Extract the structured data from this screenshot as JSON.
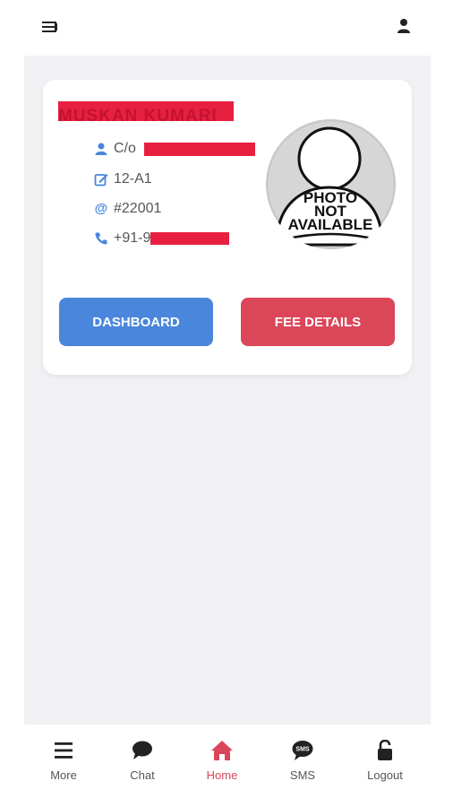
{
  "header": {
    "menu_icon": "hamburger-icon",
    "profile_icon": "user-icon"
  },
  "student": {
    "name": "MUSKAN KUMARI",
    "guardian_prefix": "C/o",
    "class_section": "12-A1",
    "admission_no": "#22001",
    "phone_prefix": "+91-9",
    "photo_text": [
      "PHOTO",
      "NOT",
      "AVAILABLE"
    ]
  },
  "buttons": {
    "dashboard": "DASHBOARD",
    "fee_details": "FEE DETAILS"
  },
  "bottom_nav": [
    {
      "label": "More",
      "icon": "menu-icon"
    },
    {
      "label": "Chat",
      "icon": "chat-bubble-icon"
    },
    {
      "label": "Home",
      "icon": "home-icon",
      "active": true
    },
    {
      "label": "SMS",
      "icon": "sms-icon"
    },
    {
      "label": "Logout",
      "icon": "unlock-icon"
    }
  ],
  "colors": {
    "accent_blue": "#4a86db",
    "accent_red": "#db4659",
    "redaction": "#e8203f",
    "background": "#f1f1f4"
  }
}
